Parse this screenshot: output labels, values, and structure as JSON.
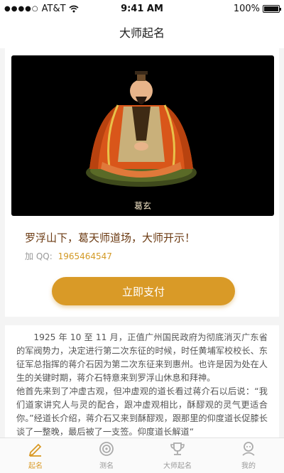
{
  "status_bar": {
    "carrier": "AT&T",
    "time": "9:41 AM",
    "battery": "100%"
  },
  "nav": {
    "title": "大师起名"
  },
  "hero": {
    "caption": "葛玄"
  },
  "info": {
    "headline": "罗浮山下，葛天师道场，大师开示！",
    "qq_label": "加 QQ:",
    "qq_value": "1965464547",
    "pay_label": "立即支付"
  },
  "story": {
    "paragraphs": [
      "1925 年 10 至 11 月，正值广州国民政府为彻底消灭广东省的军阀势力，决定进行第二次东征的时候，时任黄埔军校校长、东征军总指挥的蒋介石因为第二次东征来到惠州。也许是因为处在人生的关键时期，蒋介石特意来到罗浮山休息和拜神。",
      "他首先来到了冲虚古观，但冲虚观的道长看过蒋介石以后说：“我们道家讲究人与灵的配合，跟冲虚观相比，酥醪观的灵气更适合你。”经道长介绍，蒋介石又来到酥醪观，跟那里的仰度道长促膝长谈了一整晚，最后被了一支签。仰度道长解道“"
    ]
  },
  "tabs": [
    {
      "label": "起名",
      "icon": "pencil-icon"
    },
    {
      "label": "测名",
      "icon": "target-icon"
    },
    {
      "label": "大师起名",
      "icon": "trophy-icon"
    },
    {
      "label": "我的",
      "icon": "user-icon"
    }
  ],
  "colors": {
    "accent": "#d99a27",
    "headline": "#6b3a12",
    "hero_bg": "#000000"
  }
}
